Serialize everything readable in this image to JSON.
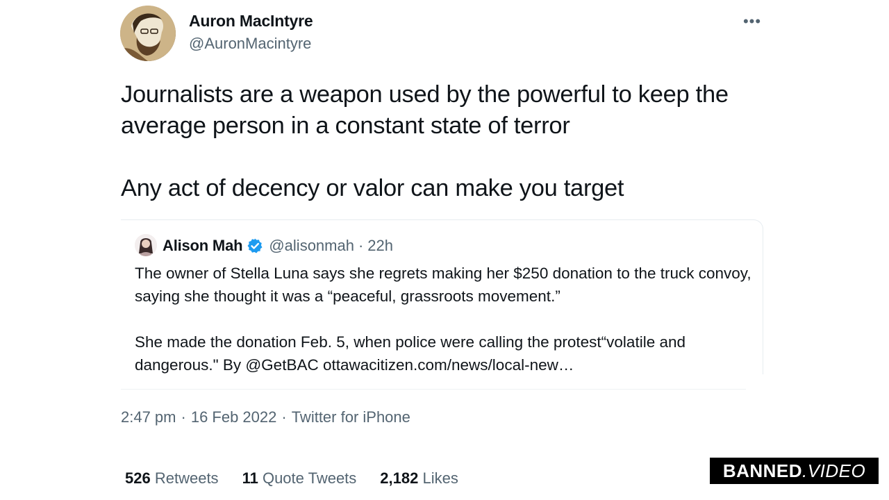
{
  "tweet": {
    "author": {
      "name": "Auron MacIntyre",
      "handle": "@AuronMacintyre",
      "avatar_icon": "user-avatar"
    },
    "more_icon": "more-horizontal-icon",
    "more_glyph": "•••",
    "text": [
      "Journalists are a weapon used by the powerful to keep the average person in a constant state of terror",
      "Any act of decency or valor can make you target"
    ],
    "quoted": {
      "author_name": "Alison Mah",
      "verified": true,
      "verified_color": "#1d9bf0",
      "handle": "@alisonmah",
      "separator": "·",
      "time": "22h",
      "text": [
        "The owner of Stella Luna says she regrets making her $250 donation to the truck convoy, saying she thought it was a “peaceful, grassroots movement.”",
        "She made the donation Feb. 5, when police were calling the protest“volatile and dangerous.\" By @GetBAC  ottawacitizen.com/news/local-new…"
      ]
    },
    "meta": {
      "time": "2:47 pm",
      "separator": "·",
      "date": "16 Feb 2022",
      "source": "Twitter for iPhone"
    },
    "stats": [
      {
        "count": "526",
        "label": "Retweets"
      },
      {
        "count": "11",
        "label": "Quote Tweets"
      },
      {
        "count": "2,182",
        "label": "Likes"
      }
    ]
  },
  "watermark": {
    "part1": "BANNED",
    "part2": ".VIDEO"
  },
  "colors": {
    "text": "#0f1419",
    "secondary": "#536471",
    "border": "#e6ecf0",
    "watermark_bg": "#000000"
  }
}
